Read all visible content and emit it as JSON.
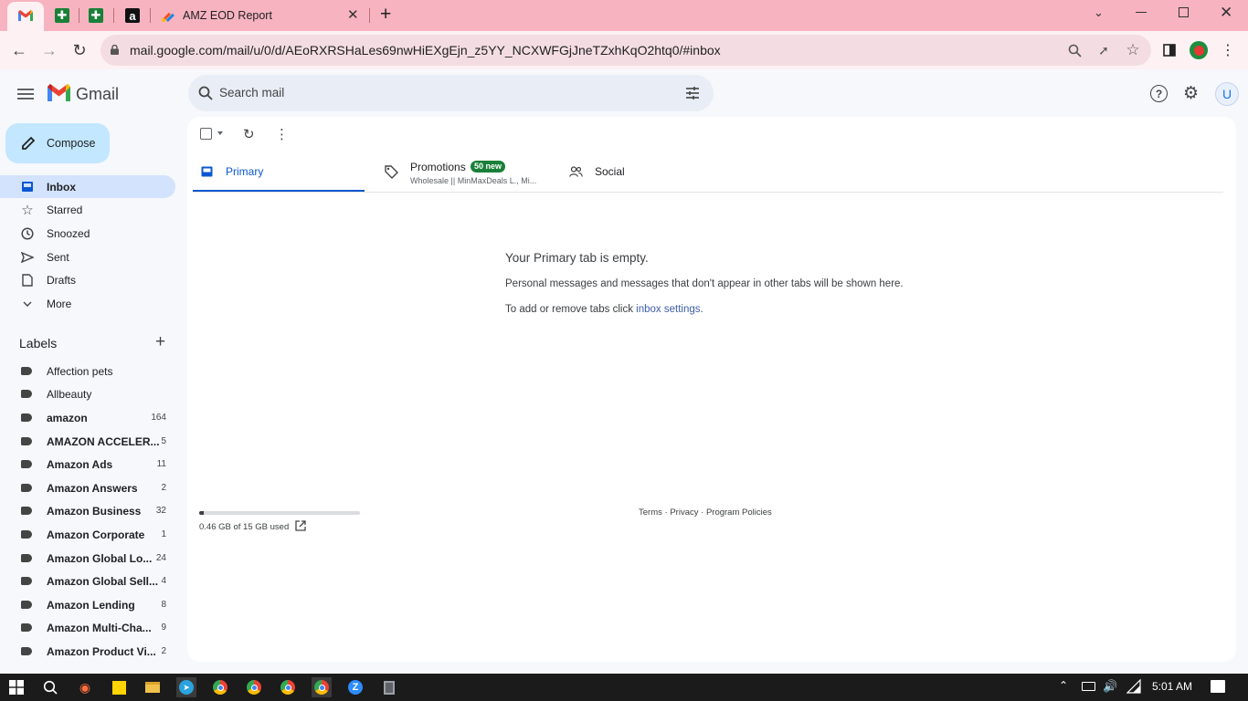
{
  "browser": {
    "tabs": [
      {
        "label": ""
      },
      {
        "label": ""
      },
      {
        "label": ""
      },
      {
        "label": ""
      },
      {
        "label": "AMZ EOD Report"
      }
    ],
    "url": "mail.google.com/mail/u/0/d/AEoRXRSHaLes69nwHiEXgEjn_z5YY_NCXWFGjJneTZxhKqO2htq0/#inbox",
    "colors": {
      "tabbar": "#f7b3c0",
      "toolbar": "#fdf1f4"
    }
  },
  "gmail": {
    "brand": "Gmail",
    "search_placeholder": "Search mail",
    "avatar_letter": "U",
    "compose_label": "Compose",
    "nav": [
      {
        "label": "Inbox",
        "icon": "inbox-icon"
      },
      {
        "label": "Starred",
        "icon": "star-icon"
      },
      {
        "label": "Snoozed",
        "icon": "clock-icon"
      },
      {
        "label": "Sent",
        "icon": "send-icon"
      },
      {
        "label": "Drafts",
        "icon": "draft-icon"
      },
      {
        "label": "More",
        "icon": "chevron-down-icon"
      }
    ],
    "labels_title": "Labels",
    "labels": [
      {
        "name": "Affection pets",
        "count": "",
        "bold": false
      },
      {
        "name": "Allbeauty",
        "count": "",
        "bold": false
      },
      {
        "name": "amazon",
        "count": "164",
        "bold": true
      },
      {
        "name": "AMAZON ACCELER...",
        "count": "5",
        "bold": true
      },
      {
        "name": "Amazon Ads",
        "count": "11",
        "bold": true
      },
      {
        "name": "Amazon Answers",
        "count": "2",
        "bold": true
      },
      {
        "name": "Amazon Business",
        "count": "32",
        "bold": true
      },
      {
        "name": "Amazon Corporate",
        "count": "1",
        "bold": true
      },
      {
        "name": "Amazon Global Lo...",
        "count": "24",
        "bold": true
      },
      {
        "name": "Amazon Global Sell...",
        "count": "4",
        "bold": true
      },
      {
        "name": "Amazon Lending",
        "count": "8",
        "bold": true
      },
      {
        "name": "Amazon Multi-Cha...",
        "count": "9",
        "bold": true
      },
      {
        "name": "Amazon Product Vi...",
        "count": "2",
        "bold": true
      }
    ],
    "tabs": {
      "primary": "Primary",
      "promotions": "Promotions",
      "promotions_badge": "50 new",
      "promotions_snippet": "Wholesale || MinMaxDeals L., Mi...",
      "social": "Social"
    },
    "empty": {
      "title": "Your Primary tab is empty.",
      "line1": "Personal messages and messages that don't appear in other tabs will be shown here.",
      "line2_prefix": "To add or remove tabs click ",
      "line2_link": "inbox settings",
      "line2_suffix": "."
    },
    "storage": {
      "text": "0.46 GB of 15 GB used",
      "fraction": 0.031
    },
    "footer": {
      "terms": "Terms",
      "sep": " · ",
      "privacy": "Privacy",
      "policies": "Program Policies"
    }
  },
  "taskbar": {
    "time": "5:01 AM"
  }
}
